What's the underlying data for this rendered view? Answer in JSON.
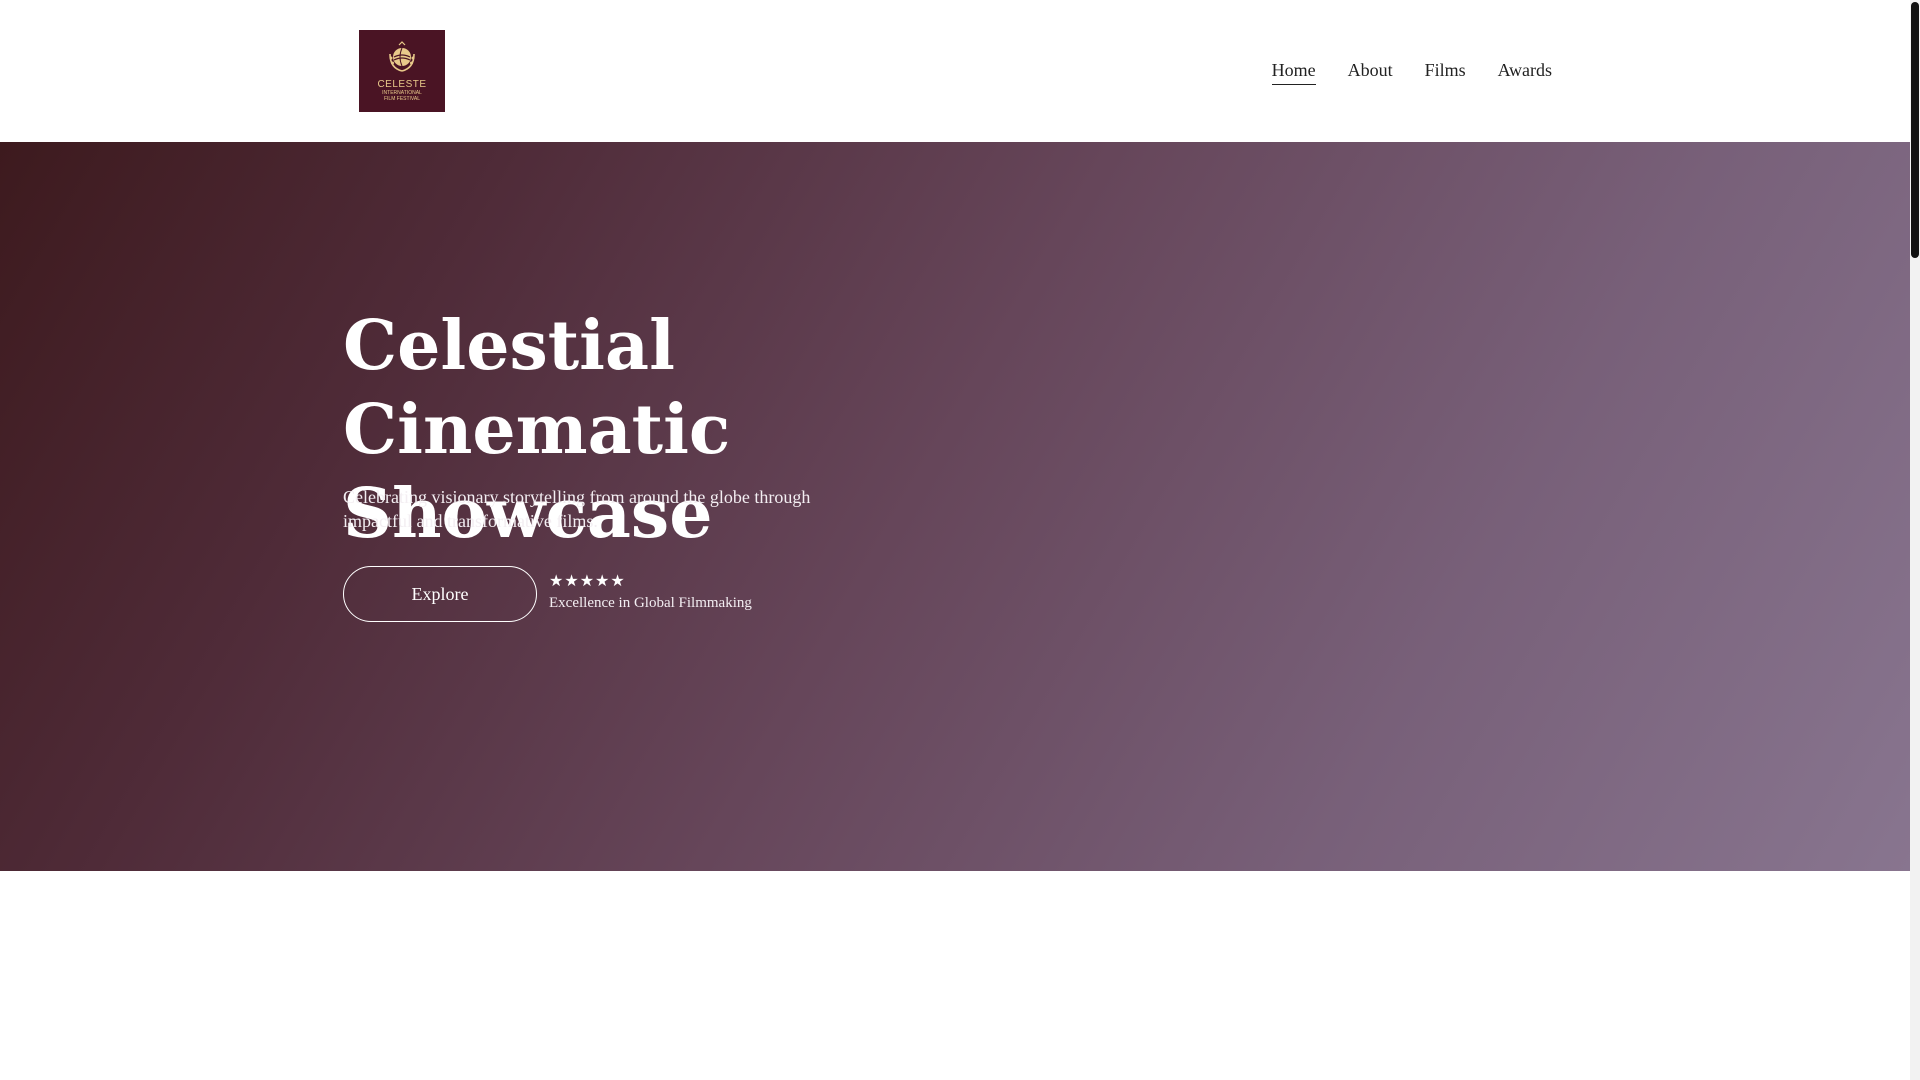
{
  "header": {
    "logo": {
      "name": "CELESTE",
      "subtitle": "INTERNATIONAL FILM FESTIVAL"
    },
    "nav": [
      {
        "label": "Home",
        "active": true
      },
      {
        "label": "About",
        "active": false
      },
      {
        "label": "Films",
        "active": false
      },
      {
        "label": "Awards",
        "active": false
      }
    ]
  },
  "hero": {
    "title": "Celestial Cinematic Showcase",
    "description": "Celebrating visionary storytelling from around the globe through impactful and transformative films.",
    "cta_label": "Explore",
    "rating": {
      "stars": "★★★★★",
      "value": 5,
      "max": 5,
      "label": "Excellence in Global Filmmaking"
    }
  },
  "colors": {
    "logo_background": "#4a1424",
    "logo_gold": "#e8c98a",
    "hero_gradient_start": "#3d1a1e",
    "hero_gradient_end": "#88758f",
    "text_dark": "#222222",
    "text_light": "#ffffff"
  },
  "icons": {
    "logo_emblem": "globe-laurel-icon",
    "rating": "star-icon"
  }
}
